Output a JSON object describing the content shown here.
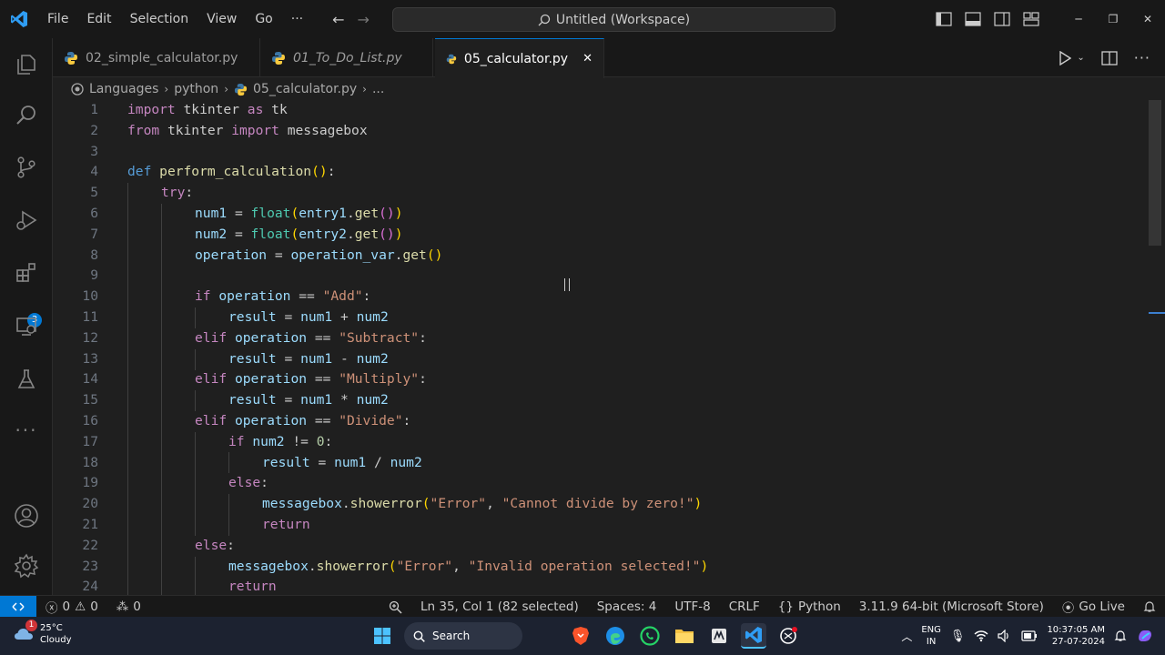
{
  "menu": [
    "File",
    "Edit",
    "Selection",
    "View",
    "Go",
    "···"
  ],
  "search": {
    "label": "Untitled (Workspace)"
  },
  "tabs": [
    {
      "label": "02_simple_calculator.py"
    },
    {
      "label": "01_To_Do_List.py"
    },
    {
      "label": "05_calculator.py",
      "close": "✕"
    }
  ],
  "breadcrumb": [
    "Languages",
    "python",
    "05_calculator.py",
    "..."
  ],
  "extensions_badge": "3",
  "line_numbers": [
    "1",
    "2",
    "3",
    "4",
    "5",
    "6",
    "7",
    "8",
    "9",
    "10",
    "11",
    "12",
    "13",
    "14",
    "15",
    "16",
    "17",
    "18",
    "19",
    "20",
    "21",
    "22",
    "23",
    "24"
  ],
  "code": {
    "l1": [
      "import",
      " tkinter ",
      "as",
      " tk"
    ],
    "l2": [
      "from",
      " tkinter ",
      "import",
      " messagebox"
    ],
    "l4": [
      "def",
      " ",
      "perform_calculation",
      "(",
      ")",
      ":"
    ],
    "l5": [
      "try",
      ":"
    ],
    "l6": [
      "num1",
      " = ",
      "float",
      "(",
      "entry1",
      ".",
      "get",
      "(",
      ")",
      ")"
    ],
    "l7": [
      "num2",
      " = ",
      "float",
      "(",
      "entry2",
      ".",
      "get",
      "(",
      ")",
      ")"
    ],
    "l8": [
      "operation",
      " = ",
      "operation_var",
      ".",
      "get",
      "(",
      ")"
    ],
    "l10": [
      "if",
      " ",
      "operation",
      " == ",
      "\"Add\"",
      ":"
    ],
    "l11": [
      "result",
      " = ",
      "num1",
      " + ",
      "num2"
    ],
    "l12": [
      "elif",
      " ",
      "operation",
      " == ",
      "\"Subtract\"",
      ":"
    ],
    "l13": [
      "result",
      " = ",
      "num1",
      " - ",
      "num2"
    ],
    "l14": [
      "elif",
      " ",
      "operation",
      " == ",
      "\"Multiply\"",
      ":"
    ],
    "l15": [
      "result",
      " = ",
      "num1",
      " * ",
      "num2"
    ],
    "l16": [
      "elif",
      " ",
      "operation",
      " == ",
      "\"Divide\"",
      ":"
    ],
    "l17": [
      "if",
      " ",
      "num2",
      " != ",
      "0",
      ":"
    ],
    "l18": [
      "result",
      " = ",
      "num1",
      " / ",
      "num2"
    ],
    "l19": [
      "else",
      ":"
    ],
    "l20": [
      "messagebox",
      ".",
      "showerror",
      "(",
      "\"Error\"",
      ", ",
      "\"Cannot divide by zero!\"",
      ")"
    ],
    "l21": [
      "return"
    ],
    "l22": [
      "else",
      ":"
    ],
    "l23": [
      "messagebox",
      ".",
      "showerror",
      "(",
      "\"Error\"",
      ", ",
      "\"Invalid operation selected!\"",
      ")"
    ],
    "l24": [
      "return"
    ]
  },
  "status": {
    "errors": "0",
    "warnings": "0",
    "ports": "0",
    "cursor": "Ln 35, Col 1 (82 selected)",
    "spaces": "Spaces: 4",
    "encoding": "UTF-8",
    "eol": "CRLF",
    "language": "Python",
    "interpreter": "3.11.9 64-bit (Microsoft Store)",
    "golive": "Go Live"
  },
  "taskbar": {
    "temp": "25°C",
    "weather": "Cloudy",
    "weather_badge": "1",
    "search": "Search",
    "lang1": "ENG",
    "lang2": "IN",
    "time": "10:37:05 AM",
    "date": "27-07-2024"
  },
  "colors": {
    "accent": "#0078d4",
    "keyword": "#c586c0",
    "function": "#dcdcaa",
    "string": "#ce9178"
  }
}
